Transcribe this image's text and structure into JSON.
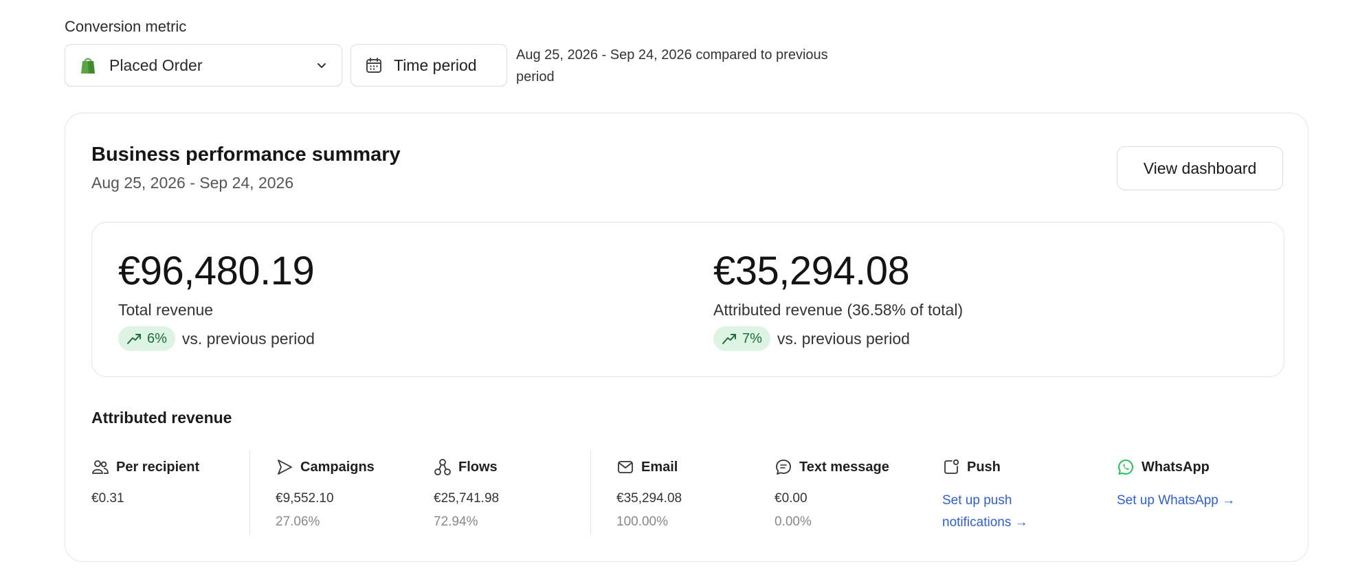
{
  "conversion": {
    "label": "Conversion metric",
    "selected": "Placed Order",
    "time_button": "Time period",
    "period_note": "Aug 25, 2026 - Sep 24, 2026 compared to previous period"
  },
  "summary": {
    "title": "Business performance summary",
    "date_range": "Aug 25, 2026 - Sep 24, 2026",
    "view_button": "View dashboard",
    "total": {
      "value": "€96,480.19",
      "label": "Total revenue",
      "change": "6%",
      "vs": "vs. previous period"
    },
    "attributed": {
      "value": "€35,294.08",
      "label": "Attributed revenue (36.58% of total)",
      "change": "7%",
      "vs": "vs. previous period"
    }
  },
  "attributed_revenue": {
    "title": "Attributed revenue",
    "per_recipient": {
      "name": "Per recipient",
      "value": "€0.31"
    },
    "campaigns": {
      "name": "Campaigns",
      "value": "€9,552.10",
      "pct": "27.06%"
    },
    "flows": {
      "name": "Flows",
      "value": "€25,741.98",
      "pct": "72.94%"
    },
    "email": {
      "name": "Email",
      "value": "€35,294.08",
      "pct": "100.00%"
    },
    "text_message": {
      "name": "Text message",
      "value": "€0.00",
      "pct": "0.00%"
    },
    "push": {
      "name": "Push",
      "link": "Set up push notifications →"
    },
    "whatsapp": {
      "name": "WhatsApp",
      "link": "Set up WhatsApp →"
    }
  },
  "colors": {
    "positive_pill_bg": "#ddf3e3",
    "positive_text": "#1e6b3a",
    "link": "#2f5fd0",
    "shopify_green": "#5aa642",
    "whatsapp_green": "#25c05a"
  },
  "icons": {
    "metric_select": "shopify-bag-icon",
    "time": "calendar-icon",
    "trend": "trend-up-icon",
    "per_recipient": "people-icon",
    "campaigns": "send-icon",
    "flows": "flow-icon",
    "email": "mail-icon",
    "text_message": "chat-bubble-icon",
    "push": "push-notification-icon",
    "whatsapp": "whatsapp-icon"
  }
}
